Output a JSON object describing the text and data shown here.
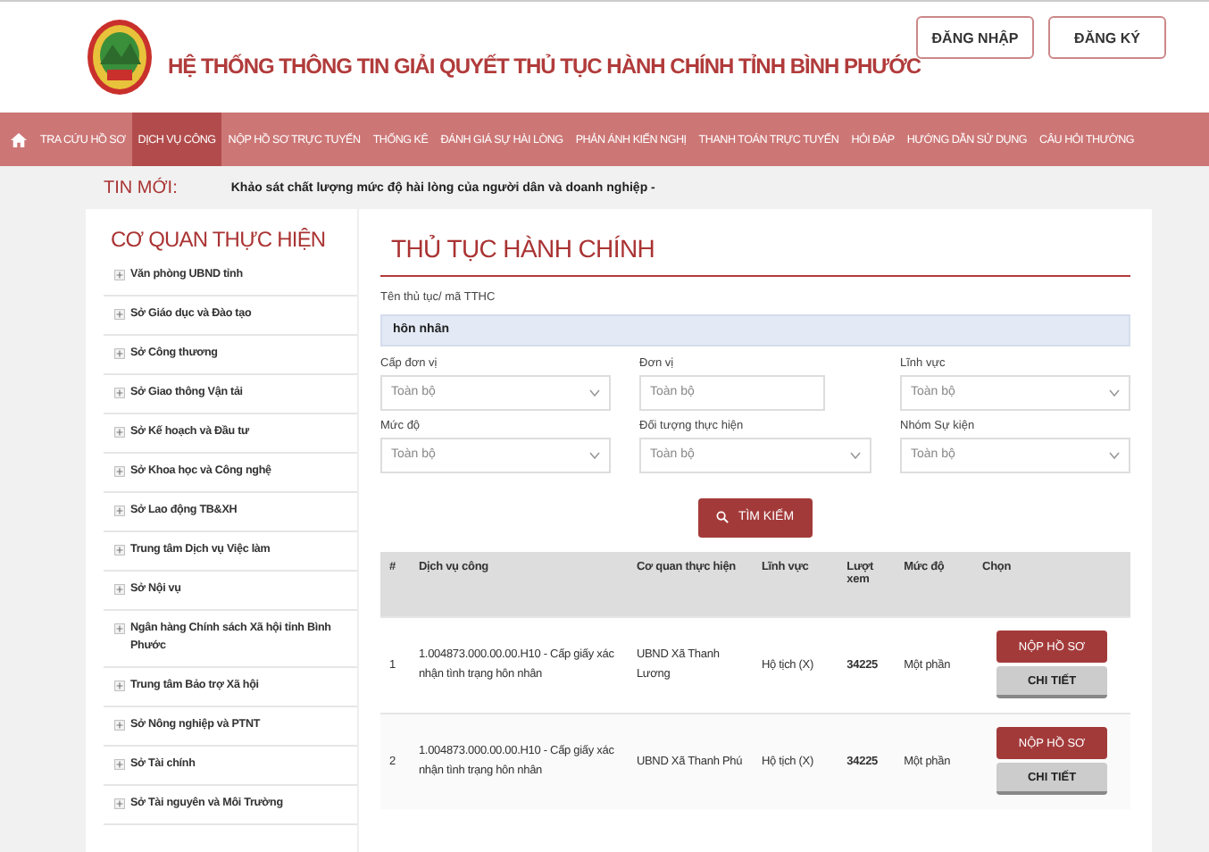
{
  "header": {
    "title": "HỆ THỐNG THÔNG TIN GIẢI QUYẾT THỦ TỤC HÀNH CHÍNH TỈNH BÌNH PHƯỚC",
    "buttons": [
      "ĐĂNG NHẬP",
      "ĐĂNG KÝ"
    ]
  },
  "nav": [
    {
      "label": "TRA CỨU HỒ SƠ",
      "selected": false
    },
    {
      "label": "DỊCH VỤ CÔNG",
      "selected": true
    },
    {
      "label": "NỘP HỒ SƠ TRỰC TUYẾN",
      "selected": false
    },
    {
      "label": "THỐNG KÊ",
      "selected": false
    },
    {
      "label": "ĐÁNH GIÁ SỰ HÀI LÒNG",
      "selected": false
    },
    {
      "label": "PHẢN ÁNH KIẾN NGHỊ",
      "selected": false
    },
    {
      "label": "THANH TOÁN TRỰC TUYẾN",
      "selected": false
    },
    {
      "label": "HỎI ĐÁP",
      "selected": false
    },
    {
      "label": "HƯỚNG DẪN SỬ DỤNG",
      "selected": false
    },
    {
      "label": "CÂU HỎI THƯỜNG",
      "selected": false
    }
  ],
  "news": {
    "label": "TIN MỚI:",
    "text": "Khảo sát chất lượng mức độ hài lòng của người dân và doanh nghiệp -"
  },
  "sidebar": {
    "title": "CƠ QUAN THỰC HIỆN",
    "items": [
      "Văn phòng UBND tỉnh",
      "Sở Giáo dục và Đào tạo",
      "Sở Công thương",
      "Sở Giao thông Vận tải",
      "Sở Kế hoạch và Đầu tư",
      "Sở Khoa học và Công nghệ",
      "Sở Lao động TB&XH",
      "Trung tâm Dịch vụ Việc làm",
      "Sở Nội vụ",
      "Ngân hàng Chính sách Xã hội tỉnh Bình Phước",
      "Trung tâm Bảo trợ Xã hội",
      "Sở Nông nghiệp và PTNT",
      "Sở Tài chính",
      "Sở Tài nguyên và Môi Trường"
    ]
  },
  "main": {
    "title": "THỦ TỤC HÀNH CHÍNH",
    "search": {
      "label": "Tên thủ tục/ mã TTHC",
      "value": "hôn nhân"
    },
    "filters": [
      {
        "label": "Cấp đơn vị",
        "placeholder": "Toàn bộ",
        "kind": "select"
      },
      {
        "label": "Đơn vị",
        "placeholder": "Toàn bộ",
        "kind": "input"
      },
      {
        "label": "Lĩnh vực",
        "placeholder": "Toàn bộ",
        "kind": "select"
      },
      {
        "label": "Mức độ",
        "placeholder": "Toàn bộ",
        "kind": "select"
      },
      {
        "label": "Đối tượng thực hiện",
        "placeholder": "Toàn bộ",
        "kind": "select"
      },
      {
        "label": "Nhóm Sự kiện",
        "placeholder": "Toàn bộ",
        "kind": "select"
      }
    ],
    "search_button": "TÌM KIẾM",
    "table": {
      "columns": [
        "#",
        "Dịch vụ công",
        "Cơ quan thực hiện",
        "Lĩnh vực",
        "Lượt xem",
        "Mức độ",
        "Chọn"
      ],
      "rows": [
        {
          "no": "1",
          "service": "1.004873.000.00.00.H10 - Cấp giấy xác nhận tình trạng hôn nhân",
          "agency": "UBND Xã Thanh Lương",
          "field": "Hộ tịch (X)",
          "views": "34225",
          "level": "Một phần",
          "buttons": [
            "NỘP HỒ SƠ",
            "CHI TIẾT"
          ]
        },
        {
          "no": "2",
          "service": "1.004873.000.00.00.H10 - Cấp giấy xác nhận tình trạng hôn nhân",
          "agency": "UBND Xã Thanh Phú",
          "field": "Hộ tịch (X)",
          "views": "34225",
          "level": "Một phần",
          "buttons": [
            "NỘP HỒ SƠ",
            "CHI TIẾT"
          ]
        }
      ]
    }
  }
}
